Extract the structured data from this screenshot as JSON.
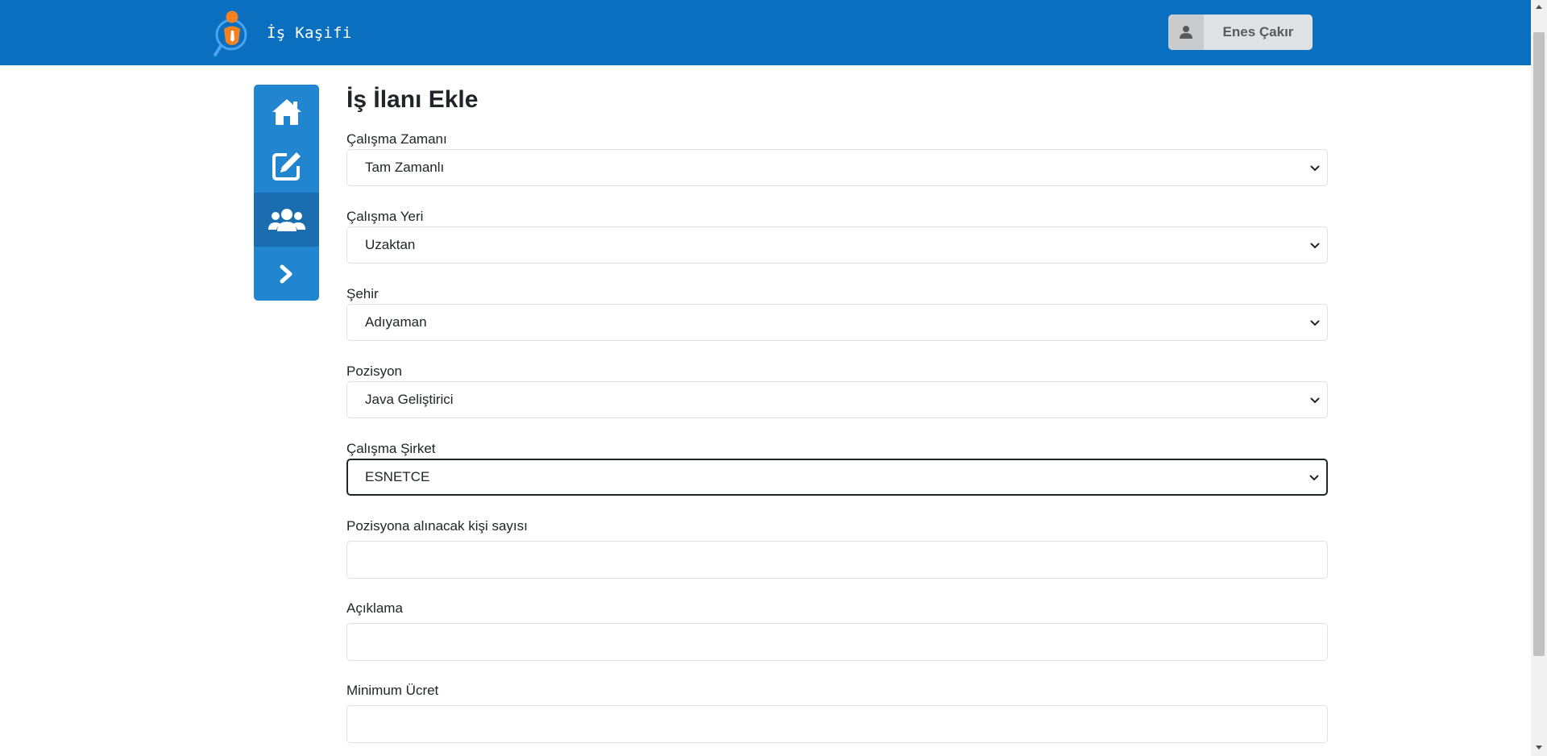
{
  "header": {
    "brand_name": "İş Kaşifi",
    "user_name": "Enes Çakır"
  },
  "sidebar": {
    "items": [
      {
        "icon": "home-icon"
      },
      {
        "icon": "edit-icon"
      },
      {
        "icon": "users-icon",
        "active": true
      },
      {
        "icon": "chevron-right-icon"
      }
    ]
  },
  "form": {
    "title": "İş İlanı Ekle",
    "working_time": {
      "label": "Çalışma Zamanı",
      "value": "Tam Zamanlı"
    },
    "working_place": {
      "label": "Çalışma Yeri",
      "value": "Uzaktan"
    },
    "city": {
      "label": "Şehir",
      "value": "Adıyaman"
    },
    "position": {
      "label": "Pozisyon",
      "value": "Java Geliştirici"
    },
    "company": {
      "label": "Çalışma Şirket",
      "value": "ESNETCE"
    },
    "open_positions": {
      "label": "Pozisyona alınacak kişi sayısı",
      "value": ""
    },
    "description": {
      "label": "Açıklama",
      "value": ""
    },
    "min_salary": {
      "label": "Minimum Ücret",
      "value": ""
    }
  },
  "colors": {
    "navbar": "#0b6fbf",
    "sidebar": "#2185d0",
    "sidebar_active": "#1a6eb0",
    "logo_orange": "#f58220",
    "logo_blue": "#1e90ff"
  }
}
